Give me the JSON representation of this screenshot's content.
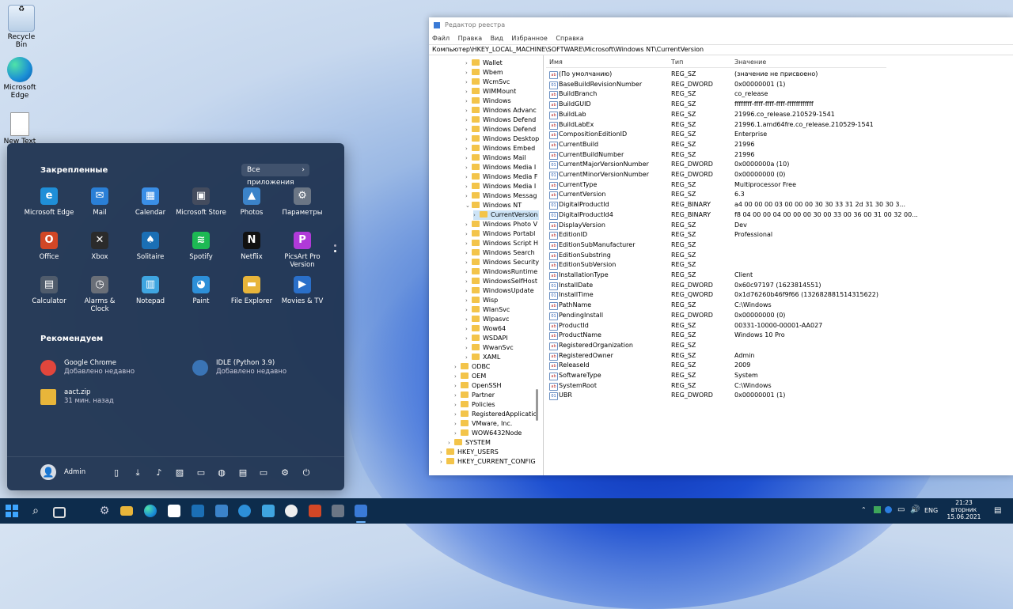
{
  "desktop": {
    "icons": [
      {
        "label": "Recycle Bin"
      },
      {
        "label": "Microsoft Edge"
      },
      {
        "label": "New Text Document"
      }
    ]
  },
  "start_menu": {
    "pinned_heading": "Закрепленные",
    "all_apps_label": "Все приложения",
    "pinned": [
      {
        "label": "Microsoft Edge",
        "color": "#1f8fd8",
        "glyph": "e"
      },
      {
        "label": "Mail",
        "color": "#2a7fd6",
        "glyph": "✉"
      },
      {
        "label": "Calendar",
        "color": "#3a8ee6",
        "glyph": "▦"
      },
      {
        "label": "Microsoft Store",
        "color": "#444c5e",
        "glyph": "▣"
      },
      {
        "label": "Photos",
        "color": "#3b83c9",
        "glyph": "▲"
      },
      {
        "label": "Параметры",
        "color": "#6b7685",
        "glyph": "⚙"
      },
      {
        "label": "Office",
        "color": "#d24726",
        "glyph": "O"
      },
      {
        "label": "Xbox",
        "color": "#2b2b2b",
        "glyph": "✕"
      },
      {
        "label": "Solitaire",
        "color": "#1b6fb5",
        "glyph": "♠"
      },
      {
        "label": "Spotify",
        "color": "#1db954",
        "glyph": "≋"
      },
      {
        "label": "Netflix",
        "color": "#111111",
        "glyph": "N"
      },
      {
        "label": "PicsArt Pro Version",
        "color": "#b03ad8",
        "glyph": "P"
      },
      {
        "label": "Calculator",
        "color": "#505c6c",
        "glyph": "▤"
      },
      {
        "label": "Alarms & Clock",
        "color": "#6a6f78",
        "glyph": "◷"
      },
      {
        "label": "Notepad",
        "color": "#3fa5e0",
        "glyph": "▥"
      },
      {
        "label": "Paint",
        "color": "#2d8fd8",
        "glyph": "◕"
      },
      {
        "label": "File Explorer",
        "color": "#e8b53a",
        "glyph": "▬"
      },
      {
        "label": "Movies & TV",
        "color": "#2a6fc9",
        "glyph": "▶"
      }
    ],
    "recommended_heading": "Рекомендуем",
    "recommended": [
      {
        "title": "Google Chrome",
        "subtitle": "Добавлено недавно",
        "color": "#e2463c"
      },
      {
        "title": "IDLE (Python 3.9)",
        "subtitle": "Добавлено недавно",
        "color": "#3a74b5"
      },
      {
        "title": "aact.zip",
        "subtitle": "31 мин. назад",
        "color": "#e8b53a"
      }
    ],
    "user_name": "Admin"
  },
  "regedit": {
    "title": "Редактор реестра",
    "menu": [
      "Файл",
      "Правка",
      "Вид",
      "Избранное",
      "Справка"
    ],
    "address": "Компьютер\\HKEY_LOCAL_MACHINE\\SOFTWARE\\Microsoft\\Windows NT\\CurrentVersion",
    "tree": [
      {
        "label": "Wallet",
        "level": 3
      },
      {
        "label": "Wbem",
        "level": 3
      },
      {
        "label": "WcmSvc",
        "level": 3
      },
      {
        "label": "WIMMount",
        "level": 3
      },
      {
        "label": "Windows",
        "level": 3
      },
      {
        "label": "Windows Advanc",
        "level": 3
      },
      {
        "label": "Windows Defend",
        "level": 3
      },
      {
        "label": "Windows Defend",
        "level": 3
      },
      {
        "label": "Windows Desktop",
        "level": 3
      },
      {
        "label": "Windows Embed",
        "level": 3
      },
      {
        "label": "Windows Mail",
        "level": 3
      },
      {
        "label": "Windows Media I",
        "level": 3
      },
      {
        "label": "Windows Media F",
        "level": 3
      },
      {
        "label": "Windows Media I",
        "level": 3
      },
      {
        "label": "Windows Messag",
        "level": 3
      },
      {
        "label": "Windows NT",
        "level": 3
      },
      {
        "label": "CurrentVersion",
        "level": 4,
        "selected": true
      },
      {
        "label": "Windows Photo V",
        "level": 3
      },
      {
        "label": "Windows Portabl",
        "level": 3
      },
      {
        "label": "Windows Script H",
        "level": 3
      },
      {
        "label": "Windows Search",
        "level": 3
      },
      {
        "label": "Windows Security",
        "level": 3
      },
      {
        "label": "WindowsRuntime",
        "level": 3
      },
      {
        "label": "WindowsSelfHost",
        "level": 3
      },
      {
        "label": "WindowsUpdate",
        "level": 3
      },
      {
        "label": "Wisp",
        "level": 3
      },
      {
        "label": "WlanSvc",
        "level": 3
      },
      {
        "label": "Wlpasvc",
        "level": 3
      },
      {
        "label": "Wow64",
        "level": 3
      },
      {
        "label": "WSDAPI",
        "level": 3
      },
      {
        "label": "WwanSvc",
        "level": 3
      },
      {
        "label": "XAML",
        "level": 3
      },
      {
        "label": "ODBC",
        "level": 2
      },
      {
        "label": "OEM",
        "level": 2
      },
      {
        "label": "OpenSSH",
        "level": 2
      },
      {
        "label": "Partner",
        "level": 2
      },
      {
        "label": "Policies",
        "level": 2
      },
      {
        "label": "RegisteredApplicatic",
        "level": 2
      },
      {
        "label": "VMware, Inc.",
        "level": 2
      },
      {
        "label": "WOW6432Node",
        "level": 2
      },
      {
        "label": "SYSTEM",
        "level": 1
      },
      {
        "label": "HKEY_USERS",
        "level": 0
      },
      {
        "label": "HKEY_CURRENT_CONFIG",
        "level": 0
      }
    ],
    "columns": [
      "Имя",
      "Тип",
      "Значение"
    ],
    "values": [
      {
        "name": "(По умолчанию)",
        "type": "REG_SZ",
        "data": "(значение не присвоено)"
      },
      {
        "name": "BaseBuildRevisionNumber",
        "type": "REG_DWORD",
        "data": "0x00000001 (1)"
      },
      {
        "name": "BuildBranch",
        "type": "REG_SZ",
        "data": "co_release"
      },
      {
        "name": "BuildGUID",
        "type": "REG_SZ",
        "data": "ffffffff-ffff-ffff-ffff-ffffffffffff"
      },
      {
        "name": "BuildLab",
        "type": "REG_SZ",
        "data": "21996.co_release.210529-1541"
      },
      {
        "name": "BuildLabEx",
        "type": "REG_SZ",
        "data": "21996.1.amd64fre.co_release.210529-1541"
      },
      {
        "name": "CompositionEditionID",
        "type": "REG_SZ",
        "data": "Enterprise"
      },
      {
        "name": "CurrentBuild",
        "type": "REG_SZ",
        "data": "21996"
      },
      {
        "name": "CurrentBuildNumber",
        "type": "REG_SZ",
        "data": "21996"
      },
      {
        "name": "CurrentMajorVersionNumber",
        "type": "REG_DWORD",
        "data": "0x0000000a (10)"
      },
      {
        "name": "CurrentMinorVersionNumber",
        "type": "REG_DWORD",
        "data": "0x00000000 (0)"
      },
      {
        "name": "CurrentType",
        "type": "REG_SZ",
        "data": "Multiprocessor Free"
      },
      {
        "name": "CurrentVersion",
        "type": "REG_SZ",
        "data": "6.3"
      },
      {
        "name": "DigitalProductId",
        "type": "REG_BINARY",
        "data": "a4 00 00 00 03 00 00 00 30 30 33 31 2d 31 30 30 3..."
      },
      {
        "name": "DigitalProductId4",
        "type": "REG_BINARY",
        "data": "f8 04 00 00 04 00 00 00 30 00 33 00 36 00 31 00 32 00..."
      },
      {
        "name": "DisplayVersion",
        "type": "REG_SZ",
        "data": "Dev"
      },
      {
        "name": "EditionID",
        "type": "REG_SZ",
        "data": "Professional"
      },
      {
        "name": "EditionSubManufacturer",
        "type": "REG_SZ",
        "data": ""
      },
      {
        "name": "EditionSubstring",
        "type": "REG_SZ",
        "data": ""
      },
      {
        "name": "EditionSubVersion",
        "type": "REG_SZ",
        "data": ""
      },
      {
        "name": "InstallationType",
        "type": "REG_SZ",
        "data": "Client"
      },
      {
        "name": "InstallDate",
        "type": "REG_DWORD",
        "data": "0x60c97197 (1623814551)"
      },
      {
        "name": "InstallTime",
        "type": "REG_QWORD",
        "data": "0x1d76260b46f9f66 (132682881514315622)"
      },
      {
        "name": "PathName",
        "type": "REG_SZ",
        "data": "C:\\Windows"
      },
      {
        "name": "PendingInstall",
        "type": "REG_DWORD",
        "data": "0x00000000 (0)"
      },
      {
        "name": "ProductId",
        "type": "REG_SZ",
        "data": "00331-10000-00001-AA027"
      },
      {
        "name": "ProductName",
        "type": "REG_SZ",
        "data": "Windows 10 Pro"
      },
      {
        "name": "RegisteredOrganization",
        "type": "REG_SZ",
        "data": ""
      },
      {
        "name": "RegisteredOwner",
        "type": "REG_SZ",
        "data": "Admin"
      },
      {
        "name": "ReleaseId",
        "type": "REG_SZ",
        "data": "2009"
      },
      {
        "name": "SoftwareType",
        "type": "REG_SZ",
        "data": "System"
      },
      {
        "name": "SystemRoot",
        "type": "REG_SZ",
        "data": "C:\\Windows"
      },
      {
        "name": "UBR",
        "type": "REG_DWORD",
        "data": "0x00000001 (1)"
      }
    ]
  },
  "taskbar": {
    "language": "ENG",
    "time": "21:23",
    "day": "вторник",
    "date": "15.06.2021"
  }
}
